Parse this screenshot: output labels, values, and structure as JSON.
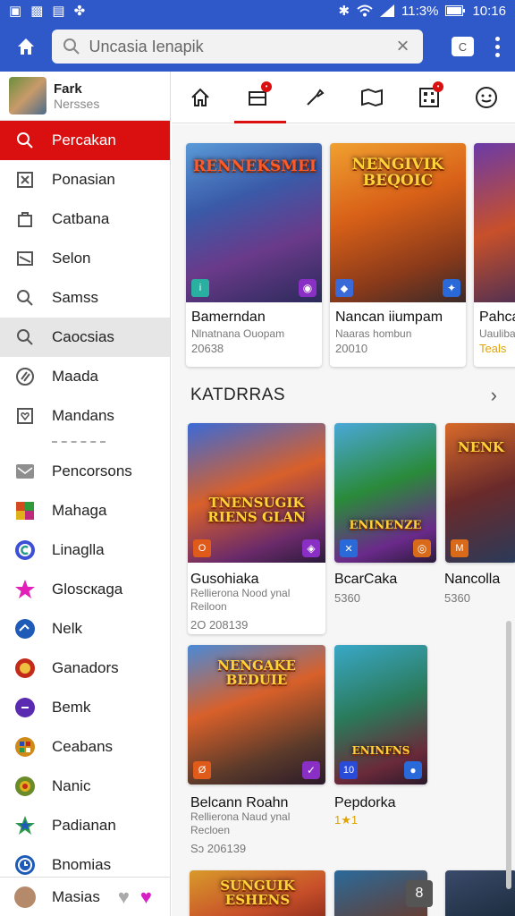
{
  "status_bar": {
    "battery": "11:3%",
    "time": "10:16"
  },
  "search": {
    "value": "Uncasia Ienapik",
    "c_button_label": "C"
  },
  "profile": {
    "name": "Fark",
    "subtitle": "Nersses"
  },
  "sidebar": {
    "items": [
      {
        "label": "Percakan",
        "icon": "search-icon"
      },
      {
        "label": "Ponasian",
        "icon": "box-x-icon"
      },
      {
        "label": "Catbana",
        "icon": "bag-icon"
      },
      {
        "label": "Selon",
        "icon": "slash-box-icon"
      },
      {
        "label": "Samss",
        "icon": "search-icon"
      },
      {
        "label": "Caocsias",
        "icon": "search-icon"
      },
      {
        "label": "Maada",
        "icon": "circle-lines-icon"
      },
      {
        "label": "Mandans",
        "icon": "heart-box-icon"
      }
    ],
    "apps": [
      {
        "label": "Pencorsons",
        "icon": "envelope-icon",
        "color": "#8e8e8e"
      },
      {
        "label": "Mahaga",
        "icon": "grid-icon",
        "color": "#d24b1f"
      },
      {
        "label": "Linaglla",
        "icon": "c-icon",
        "color": "#3d4fd6"
      },
      {
        "label": "Gloscкaga",
        "icon": "star-icon",
        "color": "#e21fb8"
      },
      {
        "label": "Nelk",
        "icon": "globe-icon",
        "color": "#1e5bb8"
      },
      {
        "label": "Ganadors",
        "icon": "face-icon",
        "color": "#c42a1a"
      },
      {
        "label": "Bemk",
        "icon": "play-icon",
        "color": "#5a2ab0"
      },
      {
        "label": "Ceabans",
        "icon": "mosaic-icon",
        "color": "#d08a1a"
      },
      {
        "label": "Nanic",
        "icon": "mosaic-icon",
        "color": "#6b8a2a"
      },
      {
        "label": "Padianan",
        "icon": "star-icon",
        "color": "#2a9a4a"
      },
      {
        "label": "Bnomias",
        "icon": "clock-icon",
        "color": "#1e5bb8"
      }
    ],
    "bottom_label": "Masias"
  },
  "featured": [
    {
      "logo": "RENNEKSMEI",
      "title": "Bamerndan",
      "sub": "Nlnatnana Ouopam",
      "meta": "20638"
    },
    {
      "logo": "NENGIVIK BEQOIC",
      "title": "Nancan iiumpam",
      "sub": "Naaras hombun",
      "meta": "20010"
    },
    {
      "logo": "",
      "title": "Pahca",
      "sub": "Uauliba",
      "meta": "Teals"
    }
  ],
  "section": {
    "title": "KATDRRAS"
  },
  "grid": [
    {
      "logo": "TNENSUGIK RIENS GLAN",
      "title": "Gusohiaka",
      "sub": "Rellierona Nood ynal",
      "sub2": "Reiloon",
      "meta": "2O 208139",
      "rating": ""
    },
    {
      "logo": "ENINENZE",
      "title": "BcarCaka",
      "sub": "",
      "sub2": "",
      "meta": "5360",
      "rating": ""
    },
    {
      "logo": "NENK",
      "title": "Nancolla",
      "sub": "",
      "sub2": "",
      "meta": "5360",
      "rating": ""
    },
    {
      "logo": "NENGAKE BEDUIE",
      "title": "Belcann Roahn",
      "sub": "Rellierona Naud ynal",
      "sub2": "Recloen",
      "meta": "Sɔ 206139",
      "rating": ""
    },
    {
      "logo": "ENINFNS",
      "title": "Pepdorka",
      "sub": "",
      "sub2": "",
      "meta": "",
      "rating": "1★1"
    }
  ],
  "bottom_row": [
    {
      "logo": "SUNGUIK ESHENS"
    },
    {
      "logo": ""
    }
  ],
  "float_button_label": "8"
}
